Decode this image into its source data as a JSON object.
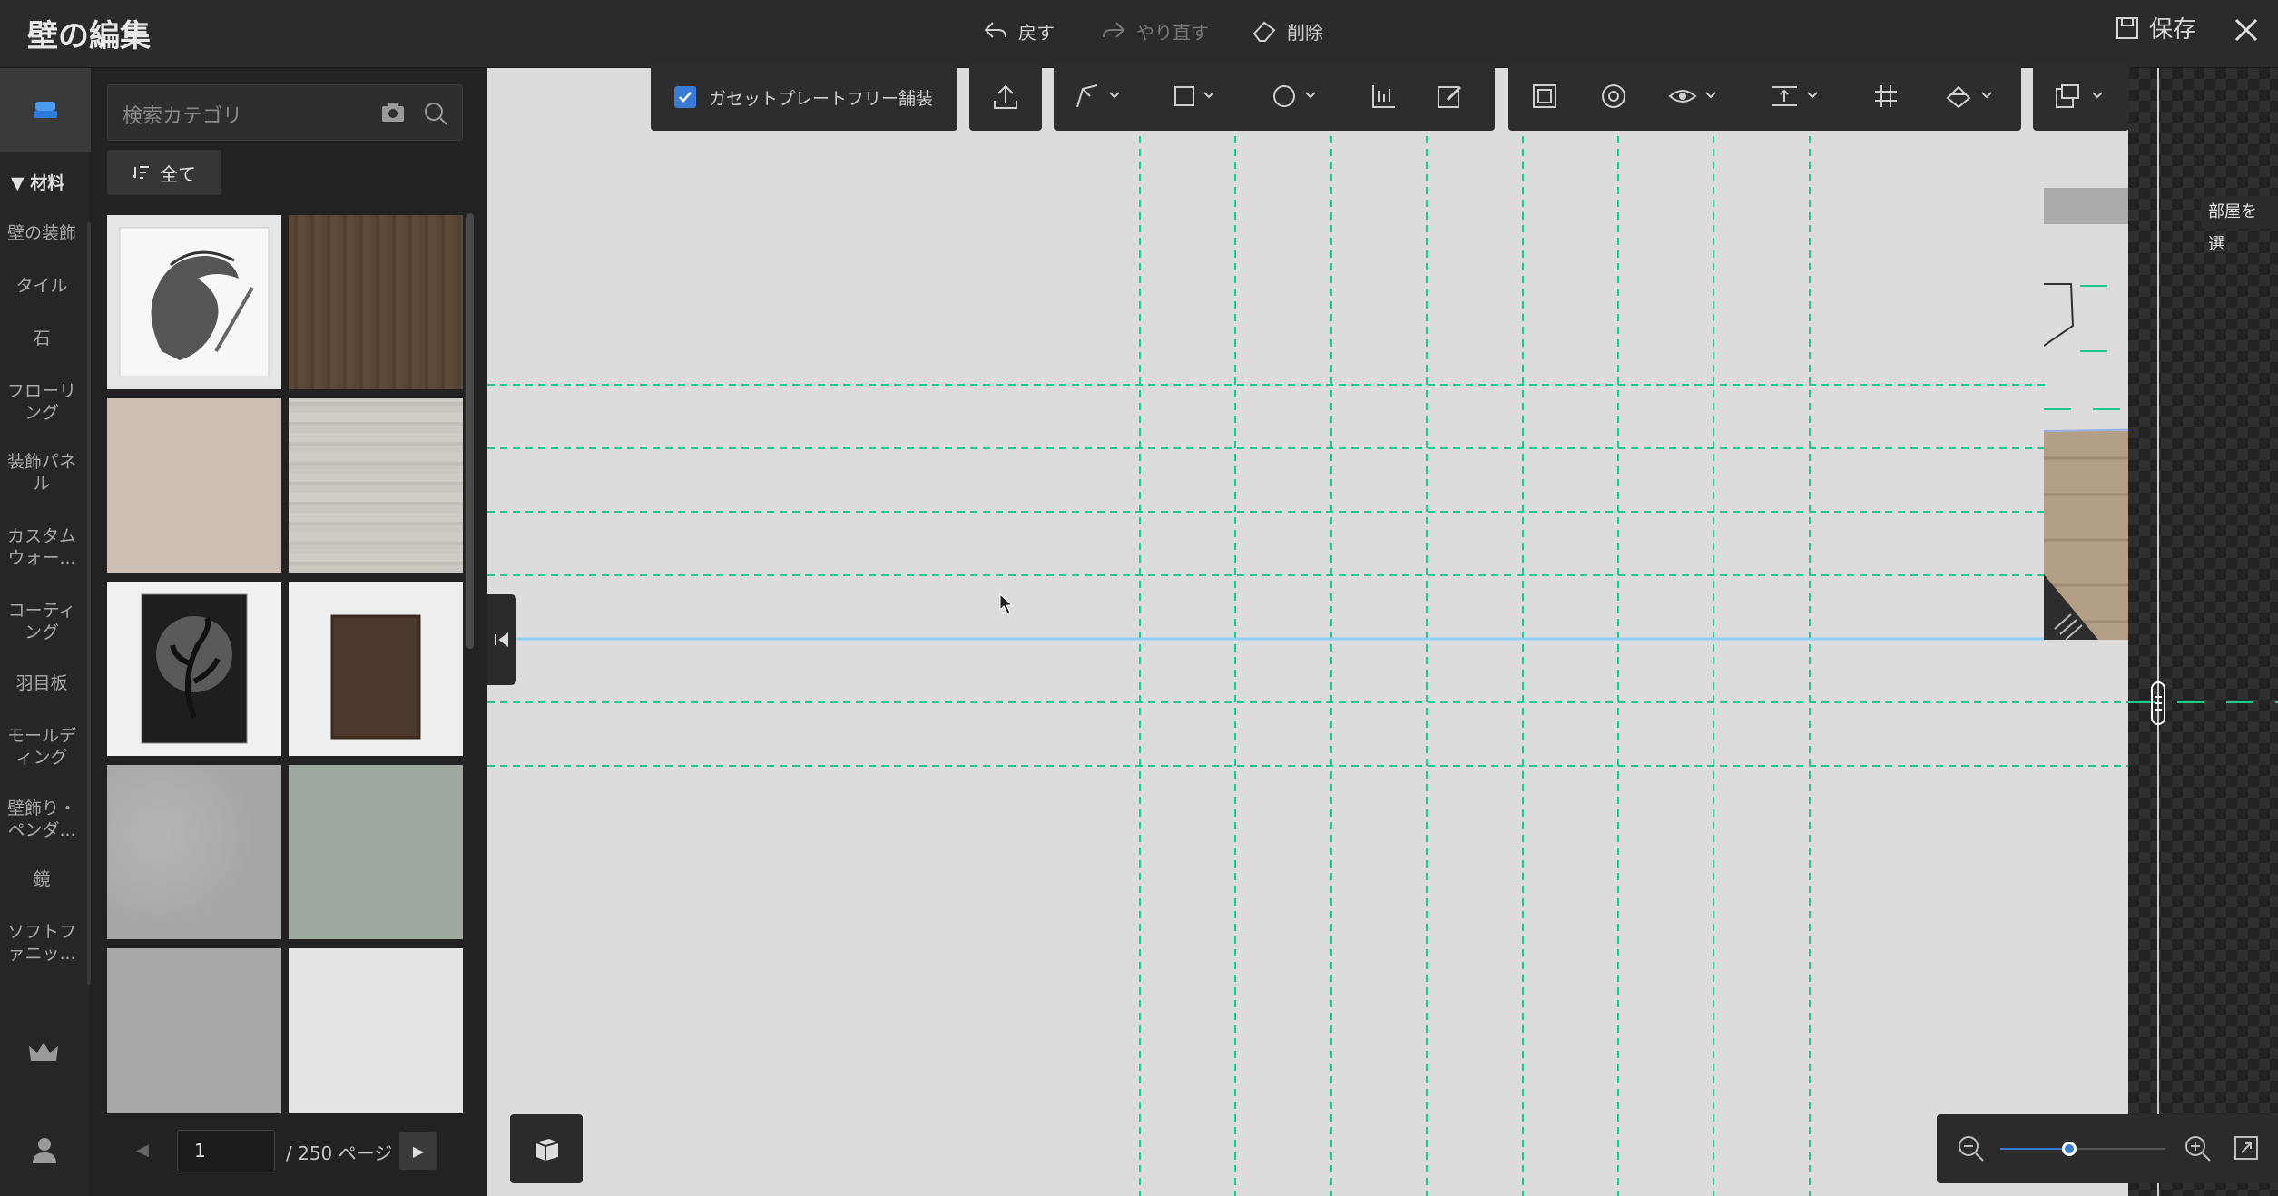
{
  "window": {
    "title": "壁の編集",
    "undo_label": "戻す",
    "redo_label": "やり直す",
    "delete_label": "削除",
    "save_label": "保存"
  },
  "rail": {
    "section_label": "材料",
    "items": [
      "壁の装飾",
      "タイル",
      "石",
      "フローリング",
      "装飾パネル",
      "カスタムウォー...",
      "コーティング",
      "羽目板",
      "モールディング",
      "壁飾り・ペンダ...",
      "鏡",
      "ソフトファニッ..."
    ]
  },
  "catalog": {
    "search_placeholder": "検索カテゴリ",
    "filter_label": "全て",
    "tiles": [
      {
        "kind": "sketch",
        "color": "#f2f2f2"
      },
      {
        "kind": "wood",
        "color": "#5a4636"
      },
      {
        "kind": "plain",
        "color": "#cdbfb3"
      },
      {
        "kind": "plain",
        "color": "#c9c4bc"
      },
      {
        "kind": "poster",
        "color": "#f0f0f0"
      },
      {
        "kind": "frame",
        "color": "#f0f0f0"
      },
      {
        "kind": "plain",
        "color": "#a9abad"
      },
      {
        "kind": "plain",
        "color": "#9ea99f"
      },
      {
        "kind": "plain",
        "color": "#a7a8aa"
      },
      {
        "kind": "plain",
        "color": "#e4e4e4"
      }
    ],
    "page_current": "1",
    "page_total": "/ 250 ページ"
  },
  "toolbar": {
    "checkbox_label": "ガセットプレートフリー舗装",
    "checkbox_checked": true
  },
  "canvas": {
    "room_tooltip": "部屋を選"
  },
  "zoom": {
    "level": 0.42
  },
  "colors": {
    "accent": "#3a7bd5",
    "grid_line": "#1fc98a",
    "wall_line": "#8fd0f5"
  }
}
